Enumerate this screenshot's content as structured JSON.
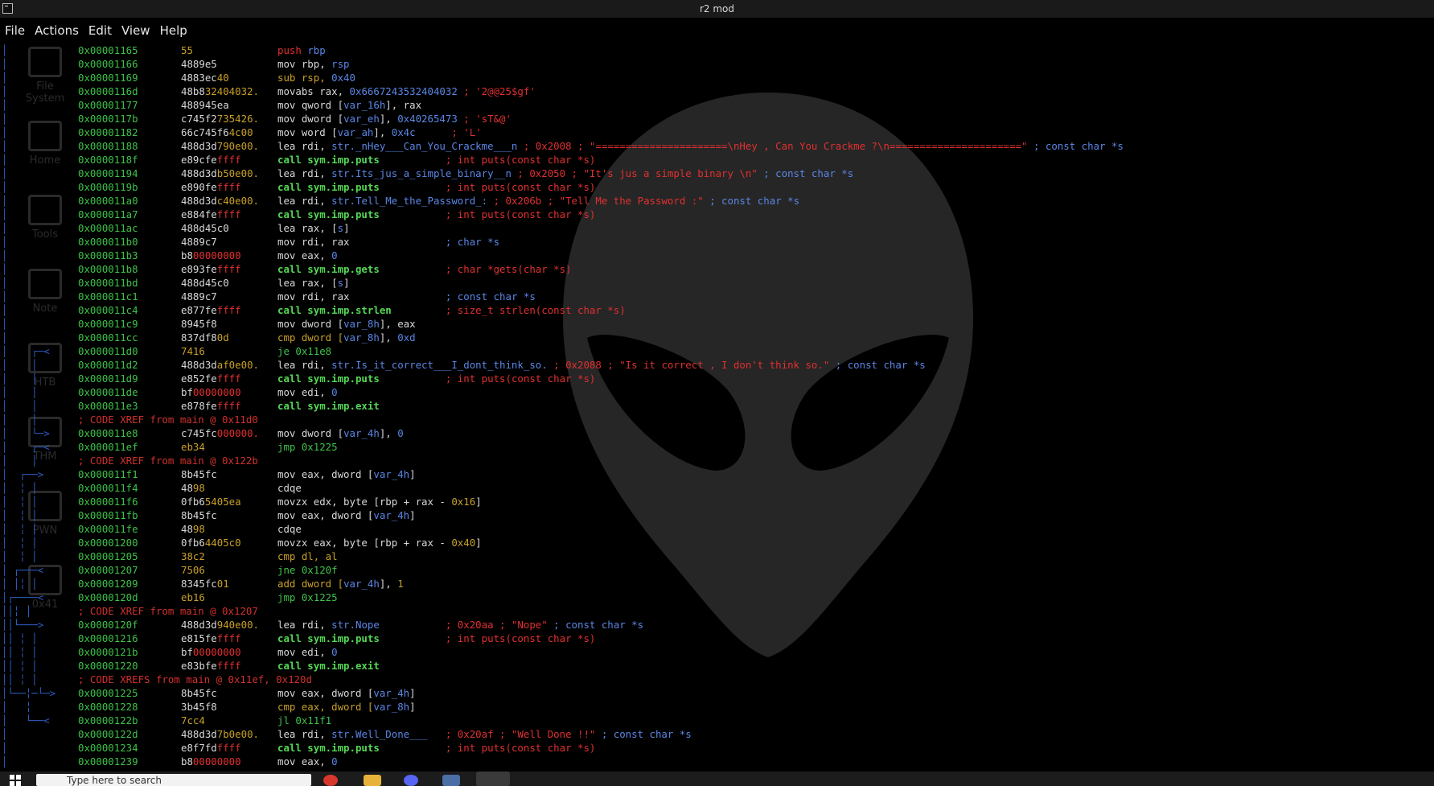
{
  "window": {
    "title": "r2 mod"
  },
  "menu": [
    "File",
    "Actions",
    "Edit",
    "View",
    "Help"
  ],
  "desktop_icons": [
    "File System",
    "Home",
    "Tools",
    "Note",
    "HTB",
    "THM",
    "PWN",
    "0x41"
  ],
  "taskbar": {
    "search_placeholder": "Type here to search"
  },
  "disasm": [
    {
      "arrow": "│",
      "addr": "0x00001165",
      "bytes": [
        [
          "55",
          "y"
        ]
      ],
      "ops": [
        [
          "push ",
          "r"
        ],
        [
          "rbp",
          "b"
        ]
      ]
    },
    {
      "arrow": "│",
      "addr": "0x00001166",
      "bytes": [
        [
          "4889e5",
          "w"
        ]
      ],
      "ops": [
        [
          "mov rbp, ",
          "w"
        ],
        [
          "rsp",
          "b"
        ]
      ]
    },
    {
      "arrow": "│",
      "addr": "0x00001169",
      "bytes": [
        [
          "4883ec",
          "w"
        ],
        [
          "40",
          "y"
        ]
      ],
      "ops": [
        [
          "sub rsp, ",
          "y"
        ],
        [
          "0x40",
          "b"
        ]
      ]
    },
    {
      "arrow": "│",
      "addr": "0x0000116d",
      "bytes": [
        [
          "48b8",
          "w"
        ],
        [
          "32404032.",
          "y"
        ]
      ],
      "ops": [
        [
          "movabs rax, ",
          "w"
        ],
        [
          "0x6667243532404032",
          "b"
        ],
        [
          " ; '2@@25$gf'",
          "r"
        ]
      ]
    },
    {
      "arrow": "│",
      "addr": "0x00001177",
      "bytes": [
        [
          "488945ea",
          "w"
        ]
      ],
      "ops": [
        [
          "mov qword [",
          "w"
        ],
        [
          "var_16h",
          "b"
        ],
        [
          "], rax",
          "w"
        ]
      ]
    },
    {
      "arrow": "│",
      "addr": "0x0000117b",
      "bytes": [
        [
          "c745f2",
          "w"
        ],
        [
          "735426.",
          "y"
        ]
      ],
      "ops": [
        [
          "mov dword [",
          "w"
        ],
        [
          "var_eh",
          "b"
        ],
        [
          "], ",
          "w"
        ],
        [
          "0x40265473",
          "b"
        ],
        [
          " ; 'sT&@'",
          "r"
        ]
      ]
    },
    {
      "arrow": "│",
      "addr": "0x00001182",
      "bytes": [
        [
          "66c745f6",
          "w"
        ],
        [
          "4c00",
          "y"
        ]
      ],
      "ops": [
        [
          "mov word [",
          "w"
        ],
        [
          "var_ah",
          "b"
        ],
        [
          "], ",
          "w"
        ],
        [
          "0x4c",
          "b"
        ],
        [
          "      ; 'L'",
          "r"
        ]
      ]
    },
    {
      "arrow": "│",
      "addr": "0x00001188",
      "bytes": [
        [
          "488d3d",
          "w"
        ],
        [
          "790e00.",
          "y"
        ]
      ],
      "ops": [
        [
          "lea rdi, ",
          "w"
        ],
        [
          "str._nHey___Can_You_Crackme___n",
          "b"
        ],
        [
          " ; 0x2008 ; \"======================\\nHey , Can You Crackme ?\\n======================\"",
          "r"
        ],
        [
          " ; const char *s",
          "b"
        ]
      ]
    },
    {
      "arrow": "│",
      "addr": "0x0000118f",
      "bytes": [
        [
          "e89cfe",
          "w"
        ],
        [
          "ffff",
          "r"
        ]
      ],
      "ops": [
        [
          "call sym.imp.puts",
          "g"
        ],
        [
          "           ; int puts(const char *s)",
          "r"
        ]
      ]
    },
    {
      "arrow": "│",
      "addr": "0x00001194",
      "bytes": [
        [
          "488d3d",
          "w"
        ],
        [
          "b50e00.",
          "y"
        ]
      ],
      "ops": [
        [
          "lea rdi, ",
          "w"
        ],
        [
          "str.Its_jus_a_simple_binary__n",
          "b"
        ],
        [
          " ; 0x2050 ; \"It's jus a simple binary \\n\"",
          "r"
        ],
        [
          " ; const char *s",
          "b"
        ]
      ]
    },
    {
      "arrow": "│",
      "addr": "0x0000119b",
      "bytes": [
        [
          "e890fe",
          "w"
        ],
        [
          "ffff",
          "r"
        ]
      ],
      "ops": [
        [
          "call sym.imp.puts",
          "g"
        ],
        [
          "           ; int puts(const char *s)",
          "r"
        ]
      ]
    },
    {
      "arrow": "│",
      "addr": "0x000011a0",
      "bytes": [
        [
          "488d3d",
          "w"
        ],
        [
          "c40e00.",
          "y"
        ]
      ],
      "ops": [
        [
          "lea rdi, ",
          "w"
        ],
        [
          "str.Tell_Me_the_Password_:",
          "b"
        ],
        [
          " ; 0x206b ; \"Tell Me the Password :\"",
          "r"
        ],
        [
          " ; const char *s",
          "b"
        ]
      ]
    },
    {
      "arrow": "│",
      "addr": "0x000011a7",
      "bytes": [
        [
          "e884fe",
          "w"
        ],
        [
          "ffff",
          "r"
        ]
      ],
      "ops": [
        [
          "call sym.imp.puts",
          "g"
        ],
        [
          "           ; int puts(const char *s)",
          "r"
        ]
      ]
    },
    {
      "arrow": "│",
      "addr": "0x000011ac",
      "bytes": [
        [
          "488d45c0",
          "w"
        ]
      ],
      "ops": [
        [
          "lea rax, [",
          "w"
        ],
        [
          "s",
          "b"
        ],
        [
          "]",
          "w"
        ]
      ]
    },
    {
      "arrow": "│",
      "addr": "0x000011b0",
      "bytes": [
        [
          "4889c7",
          "w"
        ]
      ],
      "ops": [
        [
          "mov rdi, rax",
          "w"
        ],
        [
          "                ; char *s",
          "b"
        ]
      ]
    },
    {
      "arrow": "│",
      "addr": "0x000011b3",
      "bytes": [
        [
          "b8",
          "w"
        ],
        [
          "00000000",
          "r"
        ]
      ],
      "ops": [
        [
          "mov eax, ",
          "w"
        ],
        [
          "0",
          "b"
        ]
      ]
    },
    {
      "arrow": "│",
      "addr": "0x000011b8",
      "bytes": [
        [
          "e893fe",
          "w"
        ],
        [
          "ffff",
          "r"
        ]
      ],
      "ops": [
        [
          "call sym.imp.gets",
          "g"
        ],
        [
          "           ; char *gets(char *s)",
          "r"
        ]
      ]
    },
    {
      "arrow": "│",
      "addr": "0x000011bd",
      "bytes": [
        [
          "488d45c0",
          "w"
        ]
      ],
      "ops": [
        [
          "lea rax, [",
          "w"
        ],
        [
          "s",
          "b"
        ],
        [
          "]",
          "w"
        ]
      ]
    },
    {
      "arrow": "│",
      "addr": "0x000011c1",
      "bytes": [
        [
          "4889c7",
          "w"
        ]
      ],
      "ops": [
        [
          "mov rdi, rax",
          "w"
        ],
        [
          "                ; const char *s",
          "b"
        ]
      ]
    },
    {
      "arrow": "│",
      "addr": "0x000011c4",
      "bytes": [
        [
          "e877fe",
          "w"
        ],
        [
          "ffff",
          "r"
        ]
      ],
      "ops": [
        [
          "call sym.imp.strlen",
          "g"
        ],
        [
          "         ; size_t strlen(const char *s)",
          "r"
        ]
      ]
    },
    {
      "arrow": "│",
      "addr": "0x000011c9",
      "bytes": [
        [
          "8945f8",
          "w"
        ]
      ],
      "ops": [
        [
          "mov dword [",
          "w"
        ],
        [
          "var_8h",
          "b"
        ],
        [
          "], eax",
          "w"
        ]
      ]
    },
    {
      "arrow": "│",
      "addr": "0x000011cc",
      "bytes": [
        [
          "837df8",
          "w"
        ],
        [
          "0d",
          "y"
        ]
      ],
      "ops": [
        [
          "cmp dword [",
          "y"
        ],
        [
          "var_8h",
          "b"
        ],
        [
          "], ",
          "w"
        ],
        [
          "0xd",
          "b"
        ]
      ]
    },
    {
      "arrow": "│    ┌─<",
      "addr": "0x000011d0",
      "bytes": [
        [
          "7416",
          "y"
        ]
      ],
      "ops": [
        [
          "je 0x11e8",
          "G"
        ]
      ]
    },
    {
      "arrow": "│    │",
      "addr": "0x000011d2",
      "bytes": [
        [
          "488d3d",
          "w"
        ],
        [
          "af0e00.",
          "y"
        ]
      ],
      "ops": [
        [
          "lea rdi, ",
          "w"
        ],
        [
          "str.Is_it_correct___I_dont_think_so.",
          "b"
        ],
        [
          " ; 0x2088 ; \"Is it correct , I don't think so.\"",
          "r"
        ],
        [
          " ; const char *s",
          "b"
        ]
      ]
    },
    {
      "arrow": "│    │",
      "addr": "0x000011d9",
      "bytes": [
        [
          "e852fe",
          "w"
        ],
        [
          "ffff",
          "r"
        ]
      ],
      "ops": [
        [
          "call sym.imp.puts",
          "g"
        ],
        [
          "           ; int puts(const char *s)",
          "r"
        ]
      ]
    },
    {
      "arrow": "│    │",
      "addr": "0x000011de",
      "bytes": [
        [
          "bf",
          "w"
        ],
        [
          "00000000",
          "r"
        ]
      ],
      "ops": [
        [
          "mov edi, ",
          "w"
        ],
        [
          "0",
          "b"
        ]
      ]
    },
    {
      "arrow": "│    │",
      "addr": "0x000011e3",
      "bytes": [
        [
          "e878fe",
          "w"
        ],
        [
          "ffff",
          "r"
        ]
      ],
      "ops": [
        [
          "call sym.imp.exit",
          "g"
        ]
      ]
    },
    {
      "arrow": "│    │",
      "xref": "; CODE XREF from main @ 0x11d0"
    },
    {
      "arrow": "│    └─>",
      "addr": "0x000011e8",
      "bytes": [
        [
          "c745fc",
          "w"
        ],
        [
          "000000.",
          "r"
        ]
      ],
      "ops": [
        [
          "mov dword [",
          "w"
        ],
        [
          "var_4h",
          "b"
        ],
        [
          "], ",
          "w"
        ],
        [
          "0",
          "b"
        ]
      ]
    },
    {
      "arrow": "│    ┌─<",
      "addr": "0x000011ef",
      "bytes": [
        [
          "eb34",
          "y"
        ]
      ],
      "ops": [
        [
          "jmp 0x1225",
          "G"
        ]
      ]
    },
    {
      "arrow": "│    │",
      "xref": "; CODE XREF from main @ 0x122b"
    },
    {
      "arrow": "│  ┌──>",
      "addr": "0x000011f1",
      "bytes": [
        [
          "8b45fc",
          "w"
        ]
      ],
      "ops": [
        [
          "mov eax, dword [",
          "w"
        ],
        [
          "var_4h",
          "b"
        ],
        [
          "]",
          "w"
        ]
      ]
    },
    {
      "arrow": "│  ╎ │",
      "addr": "0x000011f4",
      "bytes": [
        [
          "48",
          "w"
        ],
        [
          "98",
          "y"
        ]
      ],
      "ops": [
        [
          "cdqe",
          "w"
        ]
      ]
    },
    {
      "arrow": "│  ╎ │",
      "addr": "0x000011f6",
      "bytes": [
        [
          "0fb6",
          "w"
        ],
        [
          "5405ea",
          "y"
        ]
      ],
      "ops": [
        [
          "movzx edx, byte [rbp + rax - ",
          "w"
        ],
        [
          "0x16",
          "y"
        ],
        [
          "]",
          "w"
        ]
      ]
    },
    {
      "arrow": "│  ╎ │",
      "addr": "0x000011fb",
      "bytes": [
        [
          "8b45fc",
          "w"
        ]
      ],
      "ops": [
        [
          "mov eax, dword [",
          "w"
        ],
        [
          "var_4h",
          "b"
        ],
        [
          "]",
          "w"
        ]
      ]
    },
    {
      "arrow": "│  ╎ │",
      "addr": "0x000011fe",
      "bytes": [
        [
          "48",
          "w"
        ],
        [
          "98",
          "y"
        ]
      ],
      "ops": [
        [
          "cdqe",
          "w"
        ]
      ]
    },
    {
      "arrow": "│  ╎ │",
      "addr": "0x00001200",
      "bytes": [
        [
          "0fb6",
          "w"
        ],
        [
          "4405c0",
          "y"
        ]
      ],
      "ops": [
        [
          "movzx eax, byte [rbp + rax - ",
          "w"
        ],
        [
          "0x40",
          "y"
        ],
        [
          "]",
          "w"
        ]
      ]
    },
    {
      "arrow": "│  ╎ │",
      "addr": "0x00001205",
      "bytes": [
        [
          "38c2",
          "y"
        ]
      ],
      "ops": [
        [
          "cmp dl, al",
          "y"
        ]
      ]
    },
    {
      "arrow": "│ ┌───<",
      "addr": "0x00001207",
      "bytes": [
        [
          "7506",
          "y"
        ]
      ],
      "ops": [
        [
          "jne 0x120f",
          "G"
        ]
      ]
    },
    {
      "arrow": "│ │╎ │",
      "addr": "0x00001209",
      "bytes": [
        [
          "8345fc",
          "w"
        ],
        [
          "01",
          "y"
        ]
      ],
      "ops": [
        [
          "add dword [",
          "y"
        ],
        [
          "var_4h",
          "b"
        ],
        [
          "], ",
          "w"
        ],
        [
          "1",
          "y"
        ]
      ]
    },
    {
      "arrow": "│┌────<",
      "addr": "0x0000120d",
      "bytes": [
        [
          "eb16",
          "y"
        ]
      ],
      "ops": [
        [
          "jmp 0x1225",
          "G"
        ]
      ]
    },
    {
      "arrow": "││╎ │",
      "xref": "; CODE XREF from main @ 0x1207"
    },
    {
      "arrow": "││└───>",
      "addr": "0x0000120f",
      "bytes": [
        [
          "488d3d",
          "w"
        ],
        [
          "940e00.",
          "y"
        ]
      ],
      "ops": [
        [
          "lea rdi, ",
          "w"
        ],
        [
          "str.Nope",
          "b"
        ],
        [
          "           ; 0x20aa ; \"Nope\"",
          "r"
        ],
        [
          " ; const char *s",
          "b"
        ]
      ]
    },
    {
      "arrow": "││ ╎ │",
      "addr": "0x00001216",
      "bytes": [
        [
          "e815fe",
          "w"
        ],
        [
          "ffff",
          "r"
        ]
      ],
      "ops": [
        [
          "call sym.imp.puts",
          "g"
        ],
        [
          "           ; int puts(const char *s)",
          "r"
        ]
      ]
    },
    {
      "arrow": "││ ╎ │",
      "addr": "0x0000121b",
      "bytes": [
        [
          "bf",
          "w"
        ],
        [
          "00000000",
          "r"
        ]
      ],
      "ops": [
        [
          "mov edi, ",
          "w"
        ],
        [
          "0",
          "b"
        ]
      ]
    },
    {
      "arrow": "││ ╎ │",
      "addr": "0x00001220",
      "bytes": [
        [
          "e83bfe",
          "w"
        ],
        [
          "ffff",
          "r"
        ]
      ],
      "ops": [
        [
          "call sym.imp.exit",
          "g"
        ]
      ]
    },
    {
      "arrow": "││ ╎ │",
      "xref": "; CODE XREFS from main @ 0x11ef, 0x120d"
    },
    {
      "arrow": "│└──╎─└─>",
      "addr": "0x00001225",
      "bytes": [
        [
          "8b45fc",
          "w"
        ]
      ],
      "ops": [
        [
          "mov eax, dword [",
          "w"
        ],
        [
          "var_4h",
          "b"
        ],
        [
          "]",
          "w"
        ]
      ]
    },
    {
      "arrow": "│   ╎",
      "addr": "0x00001228",
      "bytes": [
        [
          "3b45f8",
          "w"
        ]
      ],
      "ops": [
        [
          "cmp eax, dword [",
          "y"
        ],
        [
          "var_8h",
          "b"
        ],
        [
          "]",
          "w"
        ]
      ]
    },
    {
      "arrow": "│   └──<",
      "addr": "0x0000122b",
      "bytes": [
        [
          "7cc4",
          "y"
        ]
      ],
      "ops": [
        [
          "jl 0x11f1",
          "G"
        ]
      ]
    },
    {
      "arrow": "│",
      "addr": "0x0000122d",
      "bytes": [
        [
          "488d3d",
          "w"
        ],
        [
          "7b0e00.",
          "y"
        ]
      ],
      "ops": [
        [
          "lea rdi, ",
          "w"
        ],
        [
          "str.Well_Done___",
          "b"
        ],
        [
          "   ; 0x20af ; \"Well Done !!\"",
          "r"
        ],
        [
          " ; const char *s",
          "b"
        ]
      ]
    },
    {
      "arrow": "│",
      "addr": "0x00001234",
      "bytes": [
        [
          "e8f7fd",
          "w"
        ],
        [
          "ffff",
          "r"
        ]
      ],
      "ops": [
        [
          "call sym.imp.puts",
          "g"
        ],
        [
          "           ; int puts(const char *s)",
          "r"
        ]
      ]
    },
    {
      "arrow": "│",
      "addr": "0x00001239",
      "bytes": [
        [
          "b8",
          "w"
        ],
        [
          "00000000",
          "r"
        ]
      ],
      "ops": [
        [
          "mov eax, ",
          "w"
        ],
        [
          "0",
          "b"
        ]
      ]
    }
  ],
  "colors": {
    "address": "#3fc24a",
    "call": "#55d855",
    "comment": "#e03030",
    "operand": "#5b86e5",
    "number": "#c8a028",
    "background": "#000000"
  }
}
